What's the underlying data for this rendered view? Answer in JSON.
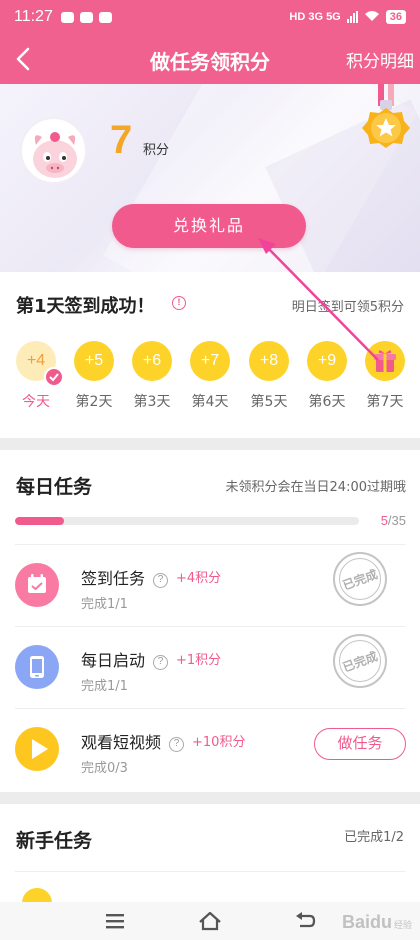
{
  "status_bar": {
    "time": "11:27",
    "right_text": "HD 3G 5G",
    "battery": "36"
  },
  "nav": {
    "title": "做任务领积分",
    "detail_link": "积分明细"
  },
  "hero": {
    "points": "7",
    "points_unit": "积分",
    "redeem_button": "兑换礼品"
  },
  "signin": {
    "title": "第1天签到成功！",
    "info_icon": "!",
    "tomorrow_hint": "明日签到可领5积分",
    "days": [
      {
        "reward": "+4",
        "label": "今天",
        "done": true
      },
      {
        "reward": "+5",
        "label": "第2天"
      },
      {
        "reward": "+6",
        "label": "第3天"
      },
      {
        "reward": "+7",
        "label": "第4天"
      },
      {
        "reward": "+8",
        "label": "第5天"
      },
      {
        "reward": "+9",
        "label": "第6天"
      },
      {
        "reward": "gift-icon",
        "label": "第7天"
      }
    ]
  },
  "daily": {
    "title": "每日任务",
    "expire_hint": "未领积分会在当日24:00过期哦",
    "progress_current": "5",
    "progress_total": "/35",
    "progress_fraction": 0.143,
    "tasks": [
      {
        "name": "签到任务",
        "reward": "+4积分",
        "progress": "完成1/1",
        "status": "已完成",
        "icon": "calendar-icon",
        "color": "#f97aa3"
      },
      {
        "name": "每日启动",
        "reward": "+1积分",
        "progress": "完成1/1",
        "status": "已完成",
        "icon": "phone-icon",
        "color": "#8aa6f5"
      },
      {
        "name": "观看短视频",
        "reward": "+10积分",
        "progress": "完成0/3",
        "status": "做任务",
        "icon": "play-icon",
        "color": "#fdc71f"
      }
    ]
  },
  "newbie": {
    "title": "新手任务",
    "done_text": "已完成1/2"
  },
  "watermark": {
    "text": "Baidu",
    "sub": "经验"
  },
  "colors": {
    "brand": "#f0618f",
    "accent": "#f15a8c",
    "points": "#f5a623",
    "coin": "#fdd32a"
  }
}
